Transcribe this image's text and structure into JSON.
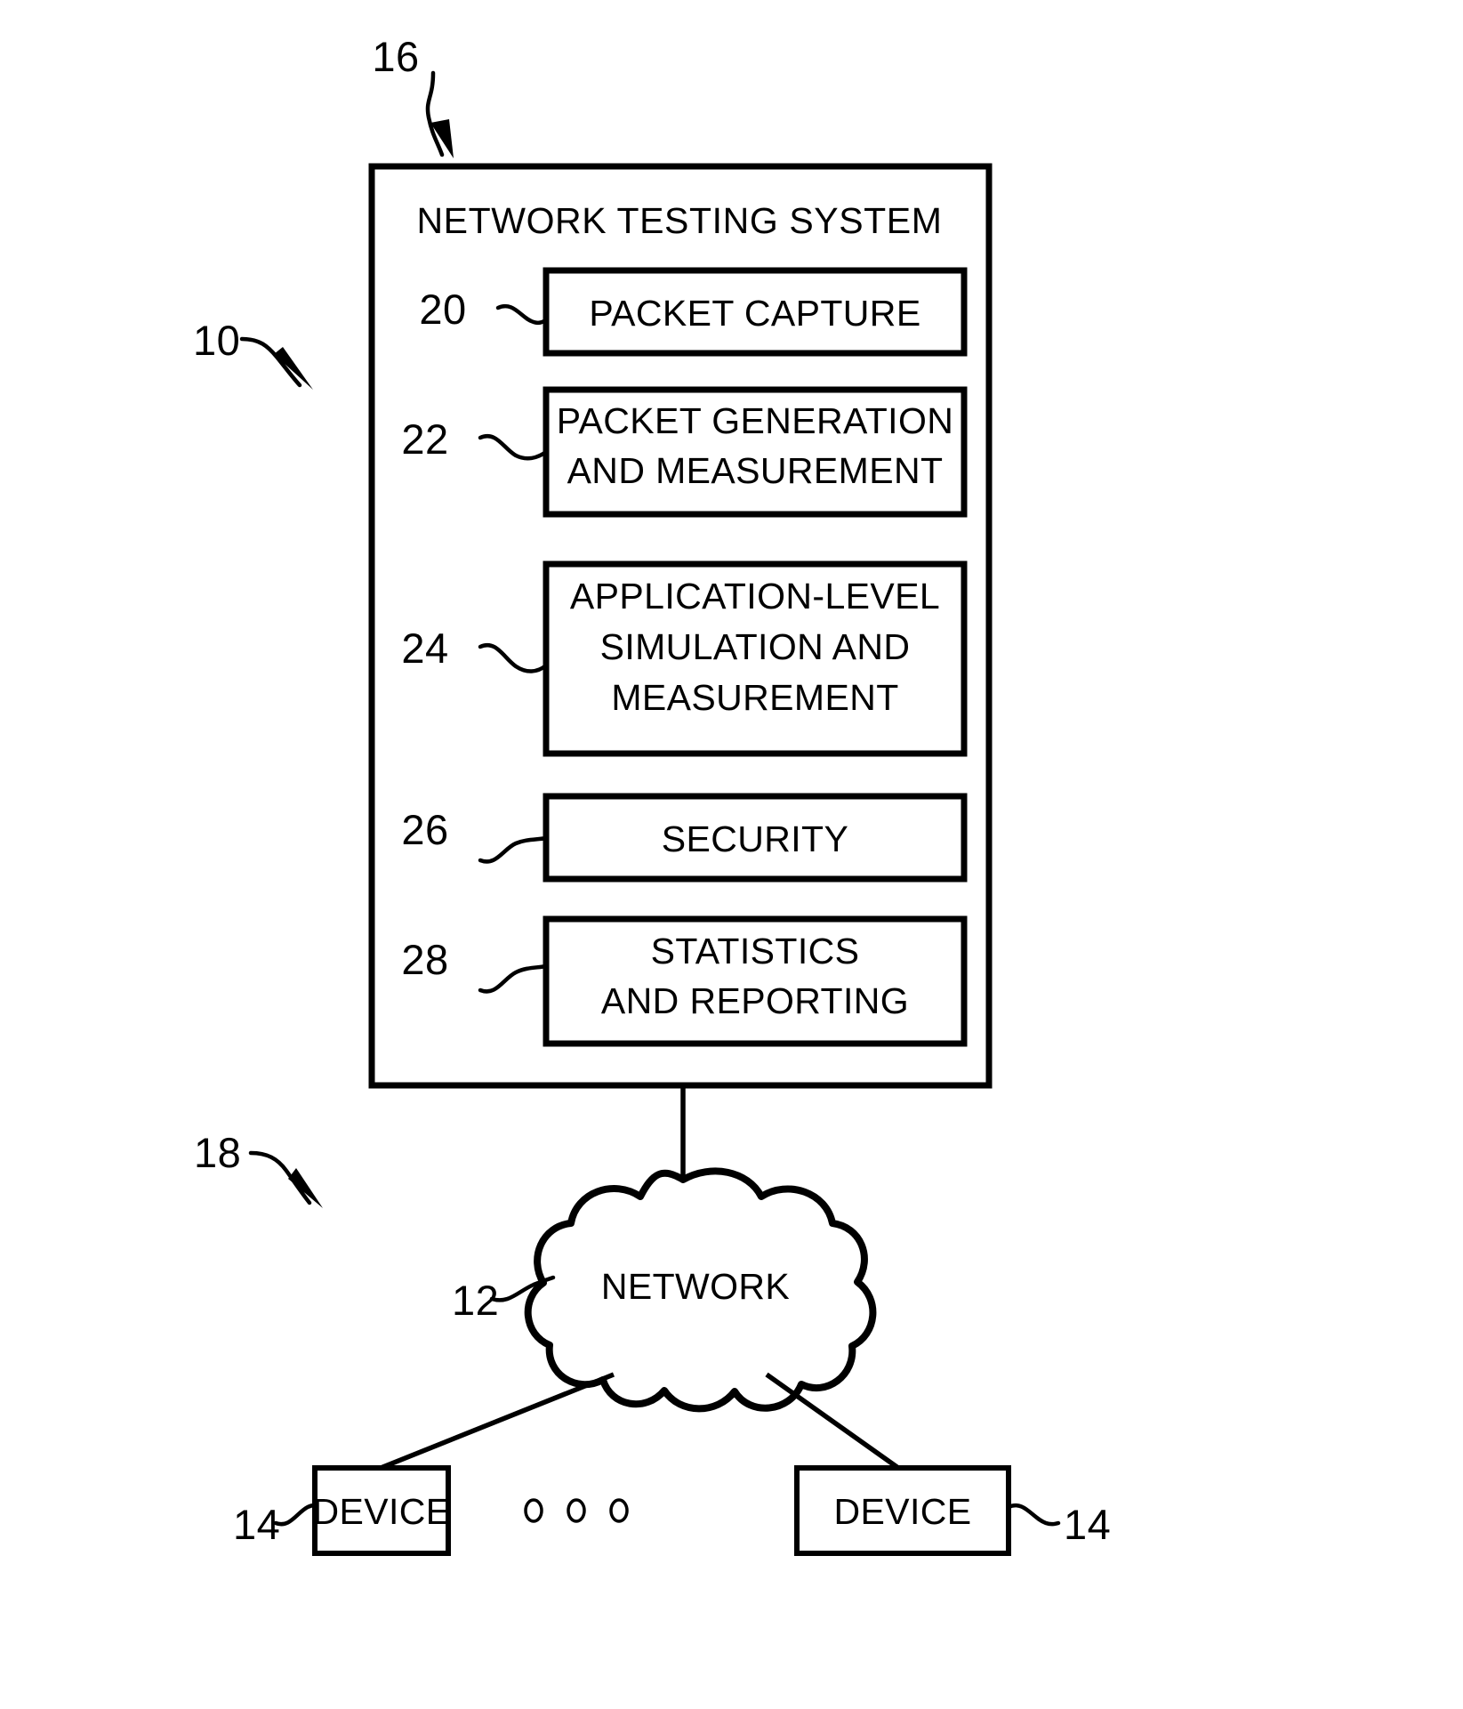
{
  "figure": {
    "system_label": "NETWORK TESTING SYSTEM",
    "reference_numerals": {
      "overall": "10",
      "network": "12",
      "device": "14",
      "device_right": "14",
      "system": "16",
      "link": "18",
      "packet_capture": "20",
      "packet_generation": "22",
      "application_level": "24",
      "security": "26",
      "statistics": "28"
    },
    "modules": [
      {
        "ref": "20",
        "lines": [
          "PACKET CAPTURE"
        ]
      },
      {
        "ref": "22",
        "lines": [
          "PACKET GENERATION",
          "AND MEASUREMENT"
        ]
      },
      {
        "ref": "24",
        "lines": [
          "APPLICATION-LEVEL",
          "SIMULATION AND",
          "MEASUREMENT"
        ]
      },
      {
        "ref": "26",
        "lines": [
          "SECURITY"
        ]
      },
      {
        "ref": "28",
        "lines": [
          "STATISTICS",
          "AND REPORTING"
        ]
      }
    ],
    "network_cloud": {
      "label": "NETWORK",
      "ref": "12"
    },
    "devices": [
      {
        "label": "DEVICE",
        "ref": "14"
      },
      {
        "label": "DEVICE",
        "ref": "14"
      }
    ],
    "ellipsis": "o o o",
    "colors": {
      "line": "#000000",
      "background": "#ffffff",
      "text": "#000000"
    }
  }
}
